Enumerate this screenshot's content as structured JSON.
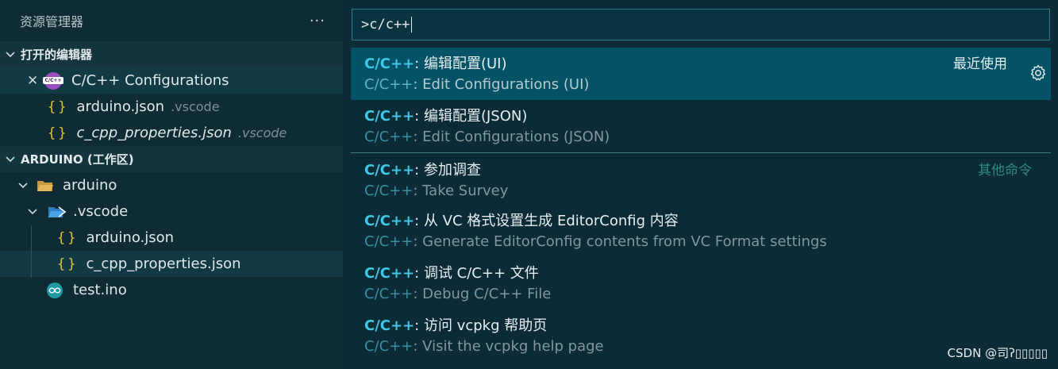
{
  "sidebar": {
    "title": "资源管理器",
    "more": "···",
    "open_editors": {
      "header": "打开的编辑器",
      "items": [
        {
          "name": "C/C++ Configurations",
          "path": ""
        },
        {
          "name": "arduino.json",
          "path": ".vscode"
        },
        {
          "name": "c_cpp_properties.json",
          "path": ".vscode"
        }
      ]
    },
    "workspace": {
      "header": "ARDUINO (工作区)",
      "root": "arduino",
      "folder": ".vscode",
      "files": [
        "arduino.json",
        "c_cpp_properties.json"
      ],
      "ino": "test.ino"
    }
  },
  "quickpick": {
    "input_value": ">c/c++",
    "prefix": "C/C++",
    "items": [
      {
        "zh": ": 编辑配置(UI)",
        "en": ": Edit Configurations (UI)",
        "category": "最近使用"
      },
      {
        "zh": ": 编辑配置(JSON)",
        "en": ": Edit Configurations (JSON)",
        "category": ""
      },
      {
        "zh": ": 参加调查",
        "en": ": Take Survey",
        "category": "其他命令"
      },
      {
        "zh": ": 从 VC 格式设置生成 EditorConfig 内容",
        "en": ": Generate EditorConfig contents from VC Format settings",
        "category": ""
      },
      {
        "zh": ": 调试 C/C++ 文件",
        "en": ": Debug C/C++ File",
        "category": ""
      },
      {
        "zh": ": 访问 vcpkg 帮助页",
        "en": ": Visit the vcpkg help page",
        "category": ""
      }
    ]
  },
  "watermark": "CSDN @司ʔ▯▯▯▯▯",
  "colors": {
    "accent": "#3fc7e6",
    "active_bg": "#035266",
    "folder": "#e3c33c"
  }
}
